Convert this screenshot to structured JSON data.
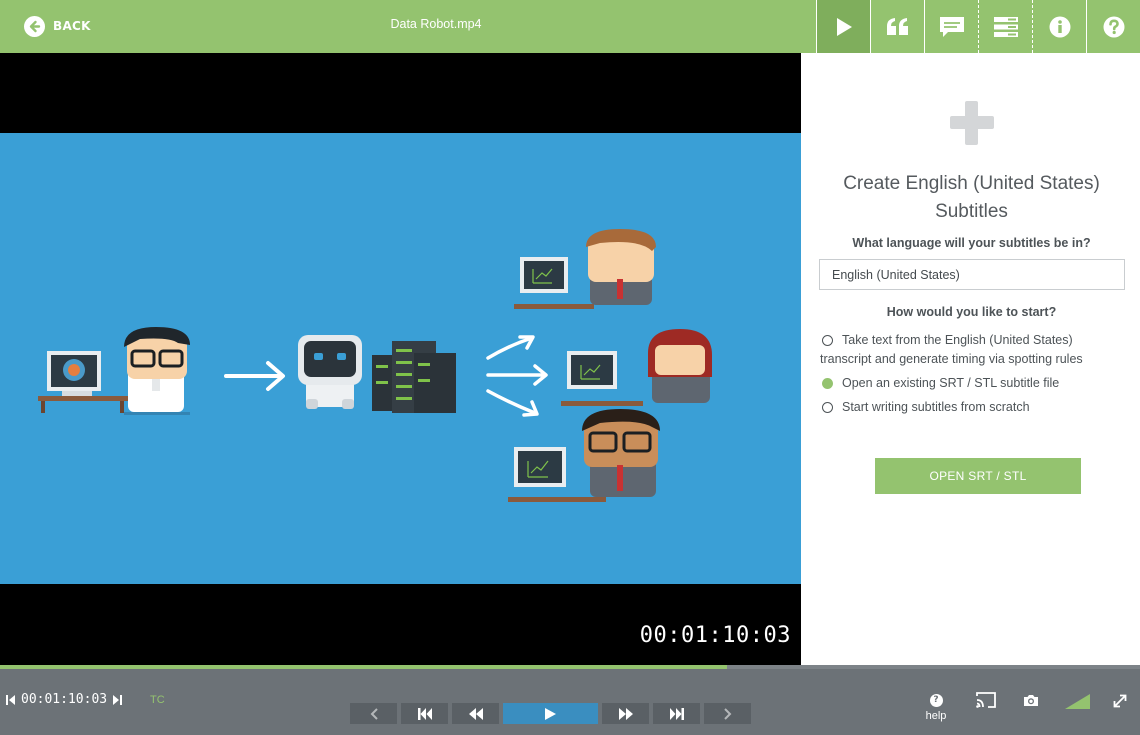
{
  "header": {
    "back_label": "BACK",
    "file_title": "Data Robot.mp4",
    "tabs": [
      {
        "name": "play",
        "icon": "play-icon",
        "active": true
      },
      {
        "name": "quotes",
        "icon": "quote-icon",
        "active": false
      },
      {
        "name": "subtitles",
        "icon": "speech-bubble-icon",
        "active": false
      },
      {
        "name": "tracks",
        "icon": "stack-icon",
        "active": false
      },
      {
        "name": "info",
        "icon": "info-icon",
        "active": false
      },
      {
        "name": "help",
        "icon": "question-icon",
        "active": false
      }
    ]
  },
  "video": {
    "timecode": "00:01:10:03"
  },
  "panel": {
    "heading": "Create English (United States) Subtitles",
    "language_question": "What language will your subtitles be in?",
    "language_value": "English (United States)",
    "start_question": "How would you like to start?",
    "options": [
      {
        "label": "Take text from the English (United States) transcript and generate timing via spotting rules",
        "selected": false
      },
      {
        "label": "Open an existing SRT / STL subtitle file",
        "selected": true
      },
      {
        "label": "Start writing subtitles from scratch",
        "selected": false
      }
    ],
    "action_label": "OPEN SRT / STL"
  },
  "controls": {
    "timecode": "00:01:10:03",
    "tc_label": "TC",
    "progress": 0.638,
    "help_label": "help"
  },
  "colors": {
    "accent": "#94c36f",
    "accent_dark": "#7fae5c",
    "video_bg": "#3a9fd6",
    "control_bar": "#6c7277",
    "play_button": "#3a8ec0"
  }
}
